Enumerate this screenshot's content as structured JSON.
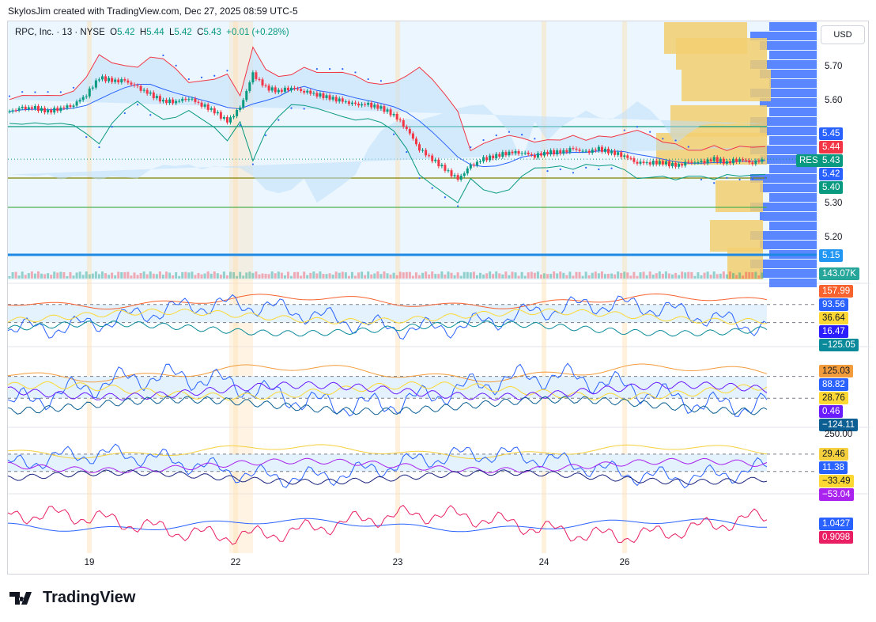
{
  "credit": "SkylosJim created with TradingView.com, Dec 27, 2025 08:59 UTC-5",
  "legend": {
    "symbol": "RPC, Inc. · 13 · NYSE",
    "o_label": "O",
    "o": "5.42",
    "h_label": "H",
    "h": "5.44",
    "l_label": "L",
    "l": "5.42",
    "c_label": "C",
    "c": "5.43",
    "change": "+0.01 (+0.28%)"
  },
  "currency": "USD",
  "res_label": "RES",
  "price_ticks": [
    "5.70",
    "5.60",
    "5.30",
    "5.20"
  ],
  "price_badges": [
    {
      "text": "5.45",
      "color": "#2962ff"
    },
    {
      "text": "5.44",
      "color": "#f23645"
    },
    {
      "text": "5.43",
      "color": "#089981"
    },
    {
      "text": "5.42",
      "color": "#2962ff"
    },
    {
      "text": "5.40",
      "color": "#089981"
    },
    {
      "text": "5.15",
      "color": "#2196f3"
    },
    {
      "text": "143.07K",
      "color": "#26a69a"
    }
  ],
  "pane_badges": [
    [
      {
        "text": "157.99",
        "color": "#f7622e"
      },
      {
        "text": "93.56",
        "color": "#2962ff"
      },
      {
        "text": "36.64",
        "color": "#fdd835",
        "dark": true
      },
      {
        "text": "16.47",
        "color": "#2a1dff"
      },
      {
        "text": "−125.05",
        "color": "#0a8a9a"
      }
    ],
    [
      {
        "text": "125.03",
        "color": "#f39c3c",
        "dark": true
      },
      {
        "text": "88.82",
        "color": "#2962ff"
      },
      {
        "text": "28.76",
        "color": "#fdd835",
        "dark": true
      },
      {
        "text": "0.46",
        "color": "#6a1bff"
      },
      {
        "text": "−124.11",
        "color": "#0c5f93"
      }
    ],
    [
      {
        "text": "29.46",
        "color": "#f4d03f",
        "dark": true
      },
      {
        "text": "11.38",
        "color": "#2962ff"
      },
      {
        "text": "−33.49",
        "color": "#fdd835",
        "dark": true
      },
      {
        "text": "−53.04",
        "color": "#aa22ee"
      }
    ],
    [
      {
        "text": "1.0427",
        "color": "#2962ff"
      },
      {
        "text": "0.9098",
        "color": "#e91e63"
      }
    ]
  ],
  "pane3_tick": "250.00",
  "logo_text": "TradingView",
  "chart_data": {
    "type": "candlestick",
    "symbol": "RPC",
    "interval": "13",
    "exchange": "NYSE",
    "x_labels": [
      "19",
      "22",
      "23",
      "24",
      "26"
    ],
    "ylim": [
      5.1,
      5.8
    ],
    "close": [
      5.57,
      5.58,
      5.58,
      5.57,
      5.58,
      5.59,
      5.62,
      5.67,
      5.66,
      5.66,
      5.64,
      5.62,
      5.6,
      5.6,
      5.61,
      5.59,
      5.57,
      5.54,
      5.58,
      5.68,
      5.64,
      5.63,
      5.64,
      5.63,
      5.62,
      5.61,
      5.6,
      5.59,
      5.59,
      5.58,
      5.56,
      5.52,
      5.46,
      5.43,
      5.4,
      5.37,
      5.41,
      5.43,
      5.44,
      5.45,
      5.45,
      5.44,
      5.45,
      5.45,
      5.46,
      5.45,
      5.46,
      5.45,
      5.44,
      5.42,
      5.42,
      5.42,
      5.41,
      5.42,
      5.42,
      5.43,
      5.42,
      5.43,
      5.42,
      5.43
    ],
    "horizontal_levels": [
      5.45,
      5.375,
      5.295,
      5.15
    ],
    "last_volume": "143.07K"
  }
}
